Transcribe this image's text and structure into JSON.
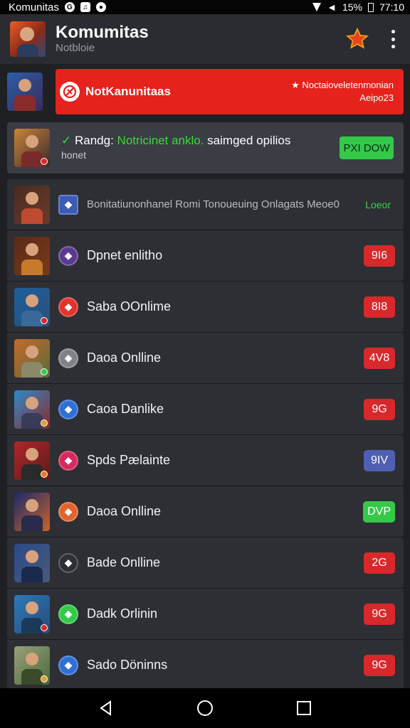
{
  "status_bar": {
    "app_name": "Komunitas",
    "battery": "15%",
    "time": "77:10"
  },
  "app_bar": {
    "title": "Komumitas",
    "subtitle": "Notbloie",
    "favorite_icon": "star-icon",
    "menu_icon": "more-vert-icon"
  },
  "notification": {
    "title": "NotKanunitaas",
    "right_line1": "★ Noctaioveletenmonian",
    "right_line2": "Aeipo23",
    "colors": {
      "banner": "#e5221c"
    }
  },
  "promo": {
    "prefix": "Randg:",
    "highlight": "Notricinet anklo.",
    "rest": "saimged opilios",
    "sub": "honet",
    "button": "PXI DOW"
  },
  "list": [
    {
      "title": "Bonitatiunonhanel Romi Tonoueuing Onlagats Meoe0",
      "badge": "Loeor",
      "badge_color": "",
      "icon_color": "#3b5bb5",
      "thumb": [
        "#4a2a22",
        "#6a3a2a",
        "#c04a30"
      ],
      "dot": ""
    },
    {
      "title": "Dpnet enlitho",
      "badge": "9I6",
      "badge_color": "#d9282b",
      "icon_color": "#5a3a8f",
      "thumb": [
        "#5a2a16",
        "#7a3a1a",
        "#c77a2a"
      ],
      "dot": ""
    },
    {
      "title": "Saba OOnlime",
      "badge": "8I8",
      "badge_color": "#d9282b",
      "icon_color": "#e0342c",
      "thumb": [
        "#1e5f9a",
        "#2a4f7a",
        "#3a6a9a"
      ],
      "dot": "#d9282b"
    },
    {
      "title": "Daoa Onlline",
      "badge": "4V8",
      "badge_color": "#d9282b",
      "icon_color": "#7f8289",
      "thumb": [
        "#c66a2a",
        "#5a6a3a",
        "#8a8a6a"
      ],
      "dot": "#35c94a"
    },
    {
      "title": "Caoa Danlike",
      "badge": "9G",
      "badge_color": "#d9282b",
      "icon_color": "#2f6fd6",
      "thumb": [
        "#2f8ac9",
        "#8a2a2a",
        "#3a3a5a"
      ],
      "dot": "#e0a02a"
    },
    {
      "title": "Spds Pælainte",
      "badge": "9IV",
      "badge_color": "#4f5fb2",
      "icon_color": "#d62a5e",
      "thumb": [
        "#b0282a",
        "#5a1a1a",
        "#2a2a2a"
      ],
      "dot": "#e07a2a"
    },
    {
      "title": "Daoa Onlline",
      "badge": "DVP",
      "badge_color": "#35c94a",
      "icon_color": "#e0642c",
      "thumb": [
        "#1a2a6a",
        "#c9642a",
        "#2a2a4a"
      ],
      "dot": ""
    },
    {
      "title": "Bade Onlline",
      "badge": "2G",
      "badge_color": "#d9282b",
      "icon_color": "#2d2f35",
      "thumb": [
        "#2a4a8a",
        "#4a5a7a",
        "#1a2a4a"
      ],
      "dot": ""
    },
    {
      "title": "Dadk Orlinin",
      "badge": "9G",
      "badge_color": "#d9282b",
      "icon_color": "#35c94a",
      "thumb": [
        "#2a7ab9",
        "#2a4a7a",
        "#1a3a5a"
      ],
      "dot": "#d9282b"
    },
    {
      "title": "Sado Döninns",
      "badge": "9G",
      "badge_color": "#d9282b",
      "icon_color": "#2f6fd6",
      "thumb": [
        "#9aa07a",
        "#4a6a3a",
        "#3a4a2a"
      ],
      "dot": "#e0a02a"
    }
  ],
  "nav": {
    "back": "back-icon",
    "home": "home-icon",
    "recents": "recents-icon"
  }
}
